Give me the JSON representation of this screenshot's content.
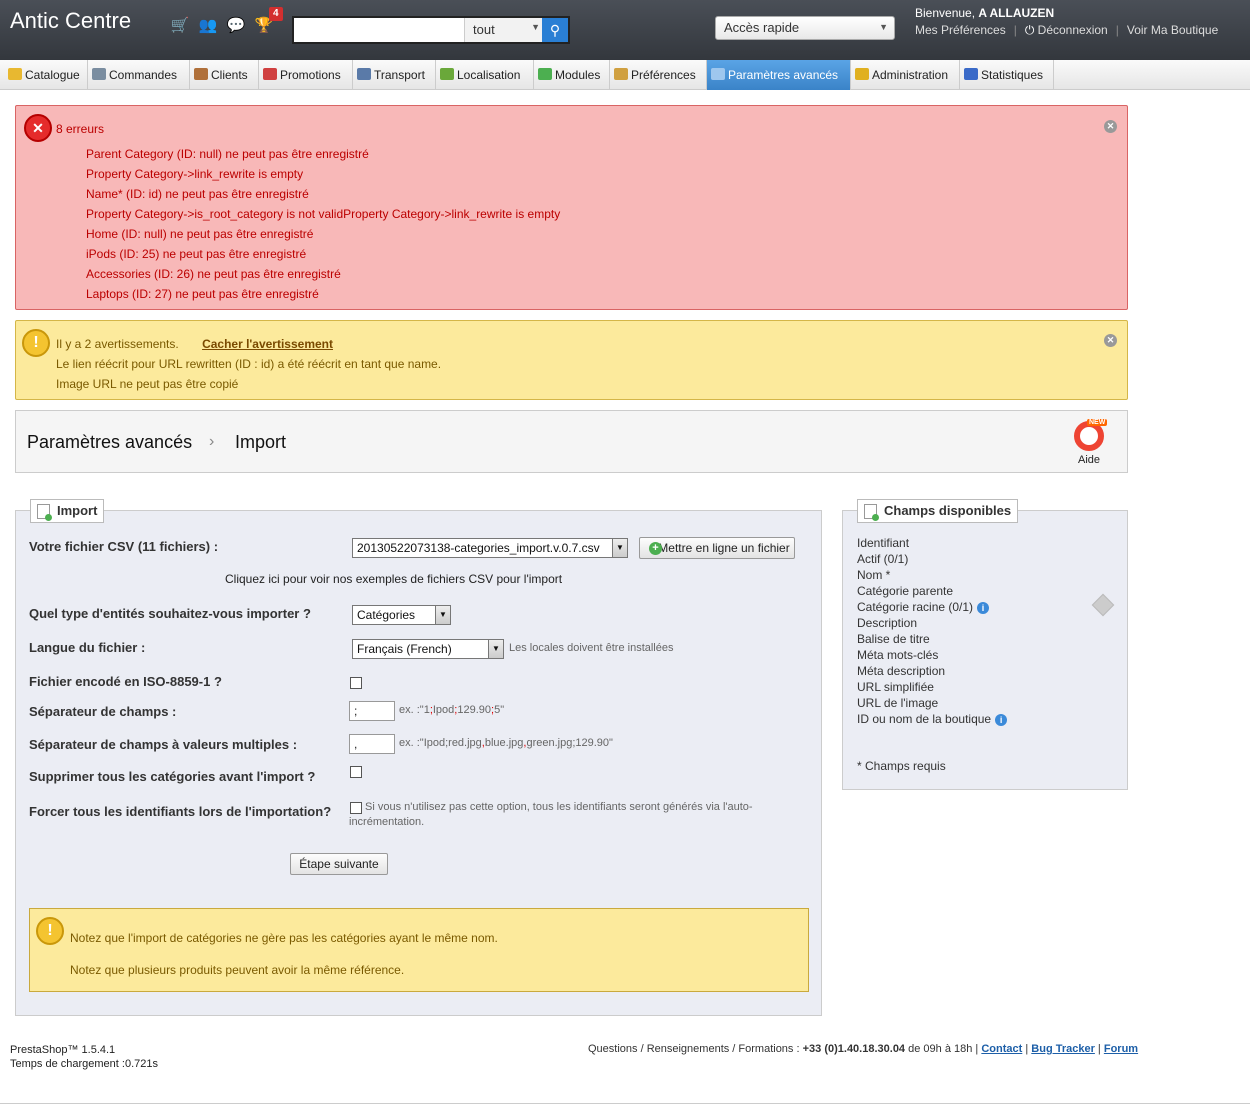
{
  "header": {
    "shop_name": "Antic Centre",
    "notification_count": "4",
    "search_placeholder": "",
    "search_scope": "tout",
    "quick_access": "Accès rapide",
    "welcome_prefix": "Bienvenue,",
    "user_name": "A ALLAUZEN",
    "links": {
      "preferences": "Mes Préférences",
      "logout": "Déconnexion",
      "view_shop": "Voir Ma Boutique"
    }
  },
  "tabs": [
    {
      "label": "Catalogue",
      "icon": "folder-icon",
      "color": "#e8b830"
    },
    {
      "label": "Commandes",
      "icon": "cart-icon",
      "color": "#7a8da0"
    },
    {
      "label": "Clients",
      "icon": "user-icon",
      "color": "#b0703a"
    },
    {
      "label": "Promotions",
      "icon": "promo-icon",
      "color": "#d04040"
    },
    {
      "label": "Transport",
      "icon": "truck-icon",
      "color": "#5a7aa8"
    },
    {
      "label": "Localisation",
      "icon": "globe-icon",
      "color": "#6aa83a"
    },
    {
      "label": "Modules",
      "icon": "puzzle-icon",
      "color": "#4caf50"
    },
    {
      "label": "Préférences",
      "icon": "prefs-icon",
      "color": "#d0a040"
    },
    {
      "label": "Paramètres avancés",
      "icon": "wrench-icon",
      "color": "#9ec7ee"
    },
    {
      "label": "Administration",
      "icon": "key-icon",
      "color": "#e0b020"
    },
    {
      "label": "Statistiques",
      "icon": "chart-icon",
      "color": "#3a6ac8"
    }
  ],
  "errors": {
    "count_label": "8 erreurs",
    "items": [
      "Parent Category (ID: null) ne peut pas être enregistré",
      "Property Category->link_rewrite is empty",
      "Name* (ID: id) ne peut pas être enregistré",
      "Property Category->is_root_category is not validProperty Category->link_rewrite is empty",
      "Home (ID: null) ne peut pas être enregistré",
      "iPods (ID: 25) ne peut pas être enregistré",
      "Accessories (ID: 26) ne peut pas être enregistré",
      "Laptops (ID: 27) ne peut pas être enregistré"
    ]
  },
  "warnings": {
    "count_label": "Il y a 2 avertissements.",
    "hide_link": "Cacher l'avertissement",
    "items": [
      "Le lien réécrit pour URL rewritten (ID : id) a été réécrit en tant que name.",
      "Image URL ne peut pas être copié"
    ]
  },
  "breadcrumb": {
    "section": "Paramètres avancés",
    "separator": "›",
    "page": "Import",
    "help_label": "Aide",
    "help_badge": "NEW"
  },
  "import_form": {
    "legend": "Import",
    "csv_label": "Votre fichier CSV (11 fichiers) :",
    "csv_value": "20130522073138-categories_import.v.0.7.csv",
    "upload_button": "Mettre en ligne un fichier",
    "examples_link": "Cliquez ici pour voir nos exemples de fichiers CSV pour l'import",
    "entity_label": "Quel type d'entités souhaitez-vous importer ?",
    "entity_value": "Catégories",
    "language_label": "Langue du fichier :",
    "language_value": "Français (French)",
    "language_hint": "Les locales doivent être installées",
    "iso_label": "Fichier encodé en ISO-8859-1 ?",
    "separator_label": "Séparateur de champs :",
    "separator_value": ";",
    "separator_hint_prefix": "ex. :\"1",
    "separator_hint_rest": "Ipod",
    "separator_hint_num": "129.90",
    "separator_hint_end": "5\"",
    "multi_separator_label": "Séparateur de champs à valeurs multiples :",
    "multi_separator_value": ",",
    "multi_hint_a": "ex. :\"Ipod;red.jpg",
    "multi_hint_b": "blue.jpg",
    "multi_hint_c": "green.jpg;129.90\"",
    "delete_label": "Supprimer tous les catégories avant l'import ?",
    "force_ids_label": "Forcer tous les identifiants lors de l'importation?",
    "force_ids_hint_1": "Si vous n'utilisez pas cette option, tous les identifiants seront générés via l'auto-",
    "force_ids_hint_2": "incrémentation.",
    "next_button": "Étape suivante",
    "notes": [
      "Notez que l'import de catégories ne gère pas les catégories ayant le même nom.",
      "Notez que plusieurs produits peuvent avoir la même référence."
    ]
  },
  "available_fields": {
    "legend": "Champs disponibles",
    "items": [
      "Identifiant",
      "Actif (0/1)",
      "Nom *",
      "Catégorie parente",
      "Catégorie racine (0/1)",
      "Description",
      "Balise de titre",
      "Méta mots-clés",
      "Méta description",
      "URL simplifiée",
      "URL de l'image",
      "ID ou nom de la boutique"
    ],
    "required_note": "* Champs requis"
  },
  "footer": {
    "version": "PrestaShop™ 1.5.4.1",
    "load_time": "Temps de chargement :0.721s",
    "contact_prefix": "Questions / Renseignements / Formations :",
    "phone": "+33 (0)1.40.18.30.04",
    "hours": "de 09h à 18h |",
    "contact": "Contact",
    "bug_tracker": "Bug Tracker",
    "forum": "Forum"
  }
}
